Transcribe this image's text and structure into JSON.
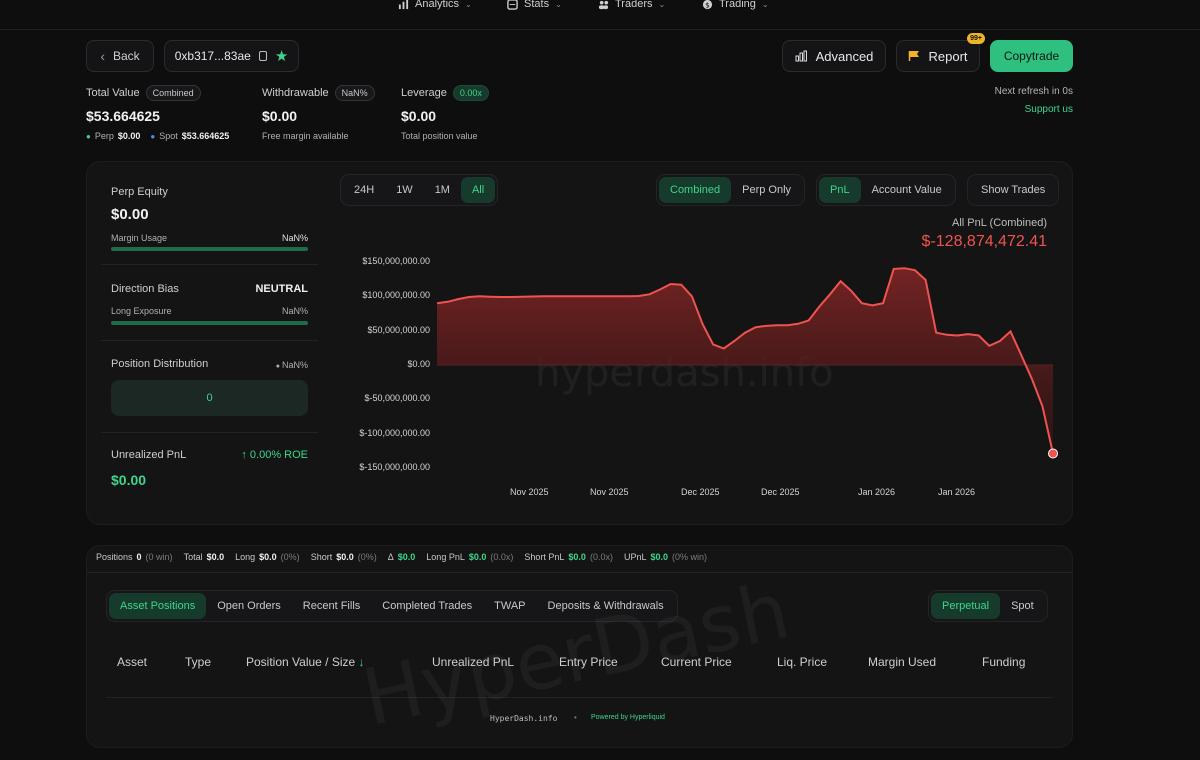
{
  "nav": [
    {
      "label": "Analytics",
      "icon": "bar-chart-icon"
    },
    {
      "label": "Stats",
      "icon": "stats-icon"
    },
    {
      "label": "Traders",
      "icon": "users-icon"
    },
    {
      "label": "Trading",
      "icon": "dollar-icon"
    }
  ],
  "header": {
    "back_label": "Back",
    "address": "0xb317...83ae",
    "advanced_label": "Advanced",
    "report_label": "Report",
    "report_badge": "99+",
    "copytrade_label": "Copytrade",
    "refresh_text": "Next refresh in 0s",
    "support_text": "Support us"
  },
  "summary": {
    "total_value_label": "Total Value",
    "total_value_tag": "Combined",
    "total_value": "$53.664625",
    "perp_label": "Perp",
    "perp_value": "$0.00",
    "spot_label": "Spot",
    "spot_value": "$53.664625",
    "withdrawable_label": "Withdrawable",
    "withdrawable_tag": "NaN%",
    "withdrawable_value": "$0.00",
    "withdrawable_sub": "Free margin available",
    "leverage_label": "Leverage",
    "leverage_tag": "0.00x",
    "leverage_value": "$0.00",
    "leverage_sub": "Total position value"
  },
  "left": {
    "perp_equity_label": "Perp Equity",
    "perp_equity_value": "$0.00",
    "margin_usage_label": "Margin Usage",
    "margin_usage_value": "NaN%",
    "direction_bias_label": "Direction Bias",
    "direction_bias_value": "NEUTRAL",
    "long_exposure_label": "Long Exposure",
    "long_exposure_value": "NaN%",
    "position_distribution_label": "Position Distribution",
    "position_distribution_pct": "NaN%",
    "position_distribution_count": "0",
    "unrealized_label": "Unrealized PnL",
    "roe_value": "↑ 0.00% ROE",
    "unrealized_value": "$0.00"
  },
  "chart_controls": {
    "ranges": [
      "24H",
      "1W",
      "1M",
      "All"
    ],
    "active_range": "All",
    "scope": [
      "Combined",
      "Perp Only"
    ],
    "metric": [
      "PnL",
      "Account Value"
    ],
    "show_trades": "Show Trades"
  },
  "chart_data": {
    "type": "area",
    "title": "All PnL (Combined)",
    "current_value": "$-128,874,472.41",
    "watermark": "hyperdash.info",
    "y_ticks": [
      "$150,000,000.00",
      "$100,000,000.00",
      "$50,000,000.00",
      "$0.00",
      "$-50,000,000.00",
      "$-100,000,000.00",
      "$-150,000,000.00"
    ],
    "x_ticks": [
      "Nov 2025",
      "Nov 2025",
      "Dec 2025",
      "Dec 2025",
      "Jan 2026",
      "Jan 2026"
    ],
    "ylim": [
      -150000000,
      150000000
    ],
    "series": [
      {
        "values": [
          90000000,
          92000000,
          96000000,
          99000000,
          100000000,
          99500000,
          99000000,
          99000000,
          99500000,
          99800000,
          100000000,
          100000000,
          100200000,
          100000000,
          100000000,
          100000000,
          100000000,
          100000000,
          100000000,
          100500000,
          103000000,
          110000000,
          118000000,
          117000000,
          100000000,
          60000000,
          30000000,
          24000000,
          35000000,
          47000000,
          55000000,
          57000000,
          58000000,
          58000000,
          60000000,
          65000000,
          85000000,
          103000000,
          122000000,
          108000000,
          90000000,
          87000000,
          90000000,
          140000000,
          141000000,
          138000000,
          124000000,
          47000000,
          44000000,
          43000000,
          45000000,
          43000000,
          28000000,
          35000000,
          49000000,
          15000000,
          -20000000,
          -60000000,
          -128874472
        ]
      }
    ],
    "line_color": "#ef5350",
    "fill_color": "#7a2424"
  },
  "stats_bar": [
    {
      "label": "Positions",
      "value": "0",
      "extra": "(0 win)"
    },
    {
      "label": "Total",
      "value": "$0.0",
      "extra": ""
    },
    {
      "label": "Long",
      "value": "$0.0",
      "extra": "(0%)"
    },
    {
      "label": "Short",
      "value": "$0.0",
      "extra": "(0%)"
    },
    {
      "label": "Δ",
      "value": "$0.0",
      "extra": ""
    },
    {
      "label": "Long PnL",
      "value": "$0.0",
      "extra": "(0.0x)"
    },
    {
      "label": "Short PnL",
      "value": "$0.0",
      "extra": "(0.0x)"
    },
    {
      "label": "UPnL",
      "value": "$0.0",
      "extra": "(0% win)"
    }
  ],
  "tabs": [
    "Asset Positions",
    "Open Orders",
    "Recent Fills",
    "Completed Trades",
    "TWAP",
    "Deposits & Withdrawals"
  ],
  "market_tabs": [
    "Perpetual",
    "Spot"
  ],
  "columns": [
    "Asset",
    "Type",
    "Position Value / Size ↓",
    "Unrealized PnL",
    "Entry Price",
    "Current Price",
    "Liq. Price",
    "Margin Used",
    "Funding"
  ],
  "footer": {
    "left": "HyperDash.info",
    "right": "Powered by Hyperliquid",
    "watermark": "HyperDash"
  },
  "colors": {
    "accent": "#3dd68c",
    "negative": "#ef5350",
    "background": "#0e0e0f"
  }
}
